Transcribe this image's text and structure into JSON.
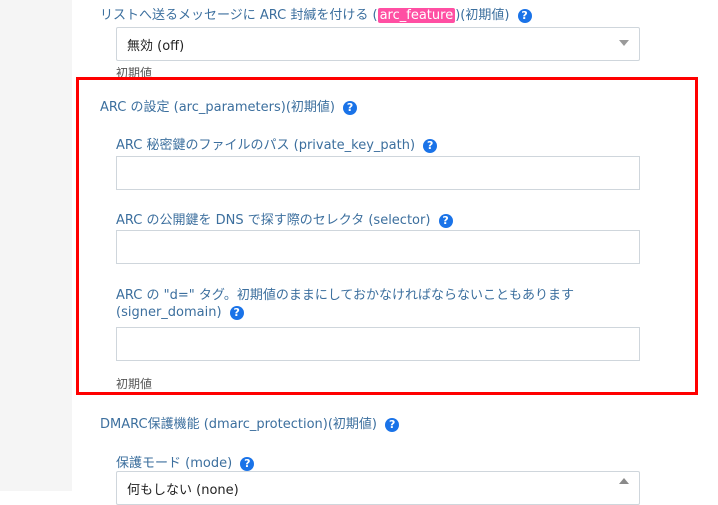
{
  "top": {
    "label_prefix": "リストへ送るメッセージに ARC 封緘を付ける (",
    "label_highlight": "arc_feature",
    "label_suffix": ")(初期値)",
    "select_value": "無効 (off)",
    "default_note": "初期値"
  },
  "arc": {
    "section_label": "ARC の設定 (arc_parameters)(初期値)",
    "private_key_path_label": "ARC 秘密鍵のファイルのパス (private_key_path)",
    "private_key_path_value": "",
    "selector_label": "ARC の公開鍵を DNS で探す際のセレクタ (selector)",
    "selector_value": "",
    "signer_domain_label_line1": "ARC の \"d=\" タグ。初期値のままにしておかなければならないこともあります",
    "signer_domain_label_line2": "(signer_domain)",
    "signer_domain_value": "",
    "default_note": "初期値"
  },
  "dmarc": {
    "section_label": "DMARC保護機能 (dmarc_protection)(初期値)",
    "mode_label": "保護モード (mode)",
    "mode_value": "何もしない (none)"
  },
  "icons": {
    "help": "?"
  },
  "colors": {
    "label": "#3c6f9e",
    "help_icon": "#1a73e8",
    "highlight": "#ff4fa3",
    "annotation_box": "#ff0000"
  }
}
